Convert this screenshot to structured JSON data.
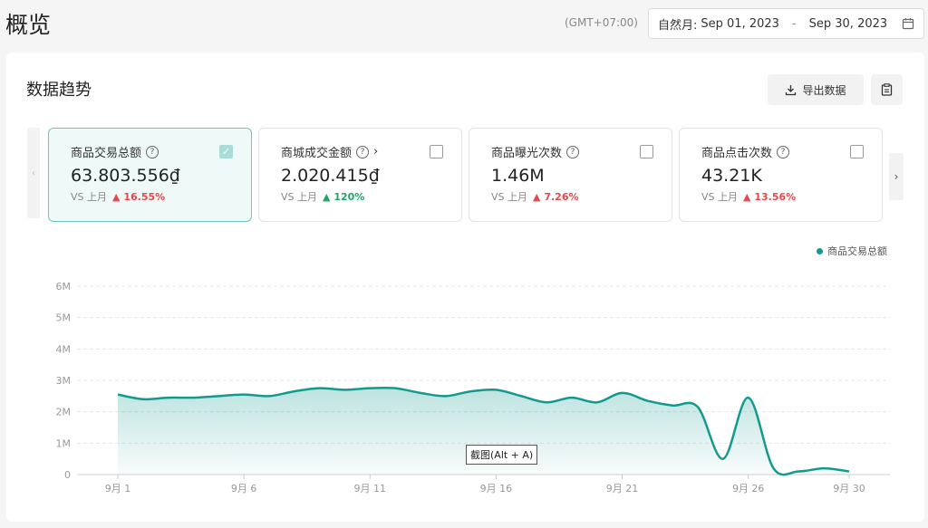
{
  "header": {
    "title": "概览",
    "timezone": "(GMT+07:00)",
    "date_label": "自然月:",
    "date_start": "Sep 01, 2023",
    "date_sep": "-",
    "date_end": "Sep 30, 2023"
  },
  "section": {
    "title": "数据趋势",
    "export_label": "导出数据"
  },
  "metrics": [
    {
      "title": "商品交易总额",
      "value": "63.803.556₫",
      "vs": "VS 上月",
      "change": "16.55%",
      "trend": "up",
      "selected": true
    },
    {
      "title": "商城成交金额",
      "value": "2.020.415₫",
      "vs": "VS 上月",
      "change": "120%",
      "trend": "up",
      "selected": false
    },
    {
      "title": "商品曝光次数",
      "value": "1.46M",
      "vs": "VS 上月",
      "change": "7.26%",
      "trend": "up",
      "selected": false
    },
    {
      "title": "商品点击次数",
      "value": "43.21K",
      "vs": "VS 上月",
      "change": "13.56%",
      "trend": "up",
      "selected": false
    }
  ],
  "tooltip": "截图(Alt + A)",
  "colors": {
    "accent": "#139a8f",
    "up_red": "#e5484d",
    "up_green": "#23a566"
  },
  "chart_data": {
    "type": "area",
    "series": [
      {
        "name": "商品交易总额",
        "values": [
          2.55,
          2.4,
          2.45,
          2.45,
          2.5,
          2.55,
          2.5,
          2.65,
          2.75,
          2.7,
          2.75,
          2.75,
          2.6,
          2.5,
          2.65,
          2.7,
          2.5,
          2.3,
          2.45,
          2.3,
          2.6,
          2.35,
          2.2,
          2.15,
          0.5,
          2.45,
          0.2,
          0.1,
          0.2,
          0.1
        ]
      }
    ],
    "x": [
      1,
      2,
      3,
      4,
      5,
      6,
      7,
      8,
      9,
      10,
      11,
      12,
      13,
      14,
      15,
      16,
      17,
      18,
      19,
      20,
      21,
      22,
      23,
      24,
      25,
      26,
      27,
      28,
      29,
      30
    ],
    "x_ticks": [
      {
        "x": 1,
        "label": "9月 1"
      },
      {
        "x": 6,
        "label": "9月 6"
      },
      {
        "x": 11,
        "label": "9月 11"
      },
      {
        "x": 16,
        "label": "9月 16"
      },
      {
        "x": 21,
        "label": "9月 21"
      },
      {
        "x": 26,
        "label": "9月 26"
      },
      {
        "x": 30,
        "label": "9月 30"
      }
    ],
    "y_ticks": [
      {
        "v": 0,
        "label": "0"
      },
      {
        "v": 1,
        "label": "1M"
      },
      {
        "v": 2,
        "label": "2M"
      },
      {
        "v": 3,
        "label": "3M"
      },
      {
        "v": 4,
        "label": "4M"
      },
      {
        "v": 5,
        "label": "5M"
      },
      {
        "v": 6,
        "label": "6M"
      }
    ],
    "ylim": [
      0,
      6
    ],
    "grid": true,
    "legend": "top-right"
  }
}
